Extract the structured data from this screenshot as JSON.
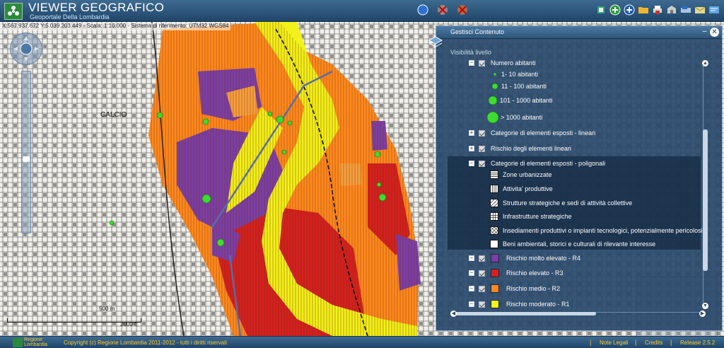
{
  "header": {
    "title": "VIEWER GEOGRAFICO",
    "subtitle": "Geoportale Della Lombardia"
  },
  "map": {
    "coord_text": "X:567.937.672  Y:5.039.203.449 - Scala: 1:10.000 - Sistema di riferimento: UTM32 WGS84",
    "place_label": "CALCIO",
    "scale_km": "500 m",
    "scale_ft": "2000 ft"
  },
  "panel": {
    "title": "Gestisci Contenuto",
    "visibility_label": "Visibilità livello",
    "items": {
      "numero_abitanti": "Numero abitanti",
      "ab1": "1- 10 abitanti",
      "ab2": "11 - 100 abitanti",
      "ab3": "101 - 1000 abitanti",
      "ab4": "> 1000 abitanti",
      "cat_lineari": "Categorie di elementi esposti - lineari",
      "rischio_lineari": "Rischio degli elementi lineari",
      "cat_poligonali": "Categorie di elementi esposti - poligonali",
      "zone": "Zone urbanizzate",
      "attivita": "Attivita' produttive",
      "strutture": "Strutture strategiche e sedi di attività collettive",
      "infrastrutture": "Infrastrutture strategiche",
      "insediamenti": "Insediamenti produttivi o impianti tecnologici, potenzialmente pericolosi",
      "beni": "Beni ambientali, storici e culturali di rilevante interesse",
      "r4": "Rischio molto elevato - R4",
      "r3": "Rischio elevato - R3",
      "r2": "Rischio medio - R2",
      "r1": "Rischio moderato - R1"
    },
    "colors": {
      "r4": "#7a3fa8",
      "r3": "#d42020",
      "r2": "#ff8a1e",
      "r1": "#f2f21a",
      "abitanti": "#3ddc2e"
    }
  },
  "footer": {
    "brand_line1": "Regione",
    "brand_line2": "Lombardia",
    "copyright": "Copyright (c) Regione Lombardia 2011-2012 - tutti i diritti riservati",
    "note_legali": "Note Legali",
    "credits": "Credits",
    "release": "Release 2.5.2"
  },
  "icons": [
    "compass-icon",
    "pan-icon",
    "globe-icon",
    "tools-icon",
    "add-layer-icon",
    "folder-icon",
    "print-icon",
    "save-icon",
    "measure-icon",
    "mail-icon",
    "help-icon"
  ]
}
